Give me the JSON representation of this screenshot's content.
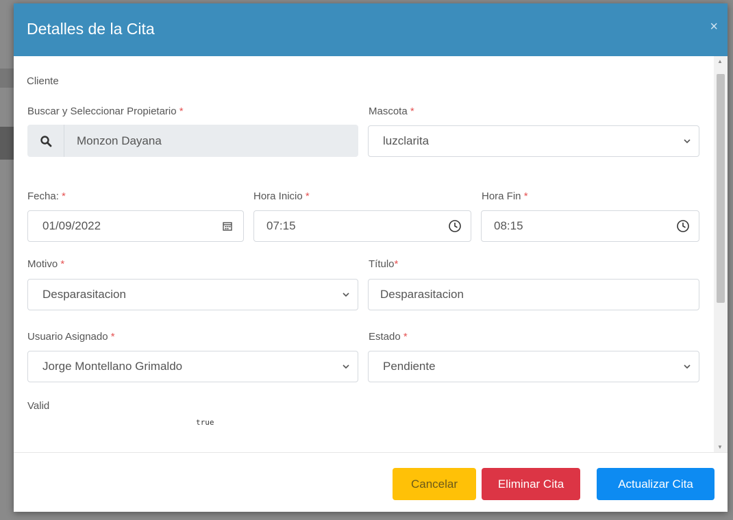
{
  "modal": {
    "title": "Detalles de la Cita",
    "close_glyph": "×"
  },
  "form": {
    "section_label": "Cliente",
    "owner": {
      "label": "Buscar y Seleccionar Propietario",
      "value": "Monzon Dayana",
      "icon": "search-icon"
    },
    "pet": {
      "label": "Mascota",
      "value": "luzclarita"
    },
    "date": {
      "label": "Fecha:",
      "value": "01/09/2022",
      "icon": "calendar-icon"
    },
    "start_time": {
      "label": "Hora Inicio",
      "value": "07:15",
      "icon": "clock-icon"
    },
    "end_time": {
      "label": "Hora Fin",
      "value": "08:15",
      "icon": "clock-icon"
    },
    "reason": {
      "label": "Motivo",
      "value": "Desparasitacion"
    },
    "title_field": {
      "label": "Título",
      "value": "Desparasitacion"
    },
    "assigned_user": {
      "label": "Usuario Asignado",
      "value": "Jorge Montellano Grimaldo"
    },
    "status": {
      "label": "Estado",
      "value": "Pendiente"
    },
    "valid": {
      "label": "Valid",
      "value": "true"
    },
    "required_mark": "*"
  },
  "footer": {
    "cancel_label": "Cancelar",
    "delete_label": "Eliminar Cita",
    "update_label": "Actualizar Cita"
  },
  "colors": {
    "header": "#3c8dbc",
    "cancel": "#ffc107",
    "delete": "#dc3545",
    "update": "#0d8bf2",
    "required": "#e55353"
  }
}
